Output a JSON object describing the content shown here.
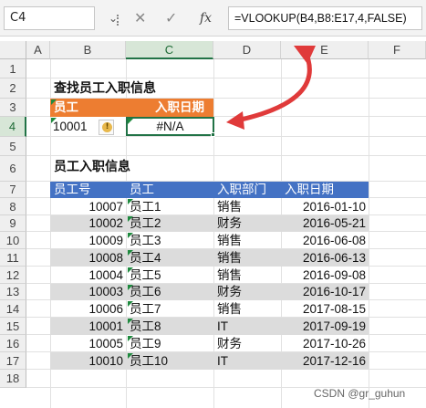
{
  "formula_bar": {
    "name_box": "C4",
    "cancel_icon": "✕",
    "enter_icon": "✓",
    "fx_label": "fx",
    "formula": "=VLOOKUP(B4,B8:E17,4,FALSE)"
  },
  "columns": [
    "A",
    "B",
    "C",
    "D",
    "E",
    "F"
  ],
  "rows": [
    "1",
    "2",
    "3",
    "4",
    "5",
    "6",
    "7",
    "8",
    "9",
    "10",
    "11",
    "12",
    "13",
    "14",
    "15",
    "16",
    "17",
    "18"
  ],
  "lookup": {
    "title": "查找员工入职信息",
    "header_employee": "员工",
    "header_hire_date": "入职日期",
    "employee_value": "10001",
    "result_value": "#N/A",
    "warning_icon": "!"
  },
  "table": {
    "title": "员工入职信息",
    "headers": [
      "员工号",
      "员工",
      "入职部门",
      "入职日期"
    ],
    "rows": [
      [
        "10007",
        "员工1",
        "销售",
        "2016-01-10"
      ],
      [
        "10002",
        "员工2",
        "财务",
        "2016-05-21"
      ],
      [
        "10009",
        "员工3",
        "销售",
        "2016-06-08"
      ],
      [
        "10008",
        "员工4",
        "销售",
        "2016-06-13"
      ],
      [
        "10004",
        "员工5",
        "销售",
        "2016-09-08"
      ],
      [
        "10003",
        "员工6",
        "财务",
        "2016-10-17"
      ],
      [
        "10006",
        "员工7",
        "销售",
        "2017-08-15"
      ],
      [
        "10001",
        "员工8",
        "IT",
        "2017-09-19"
      ],
      [
        "10005",
        "员工9",
        "财务",
        "2017-10-26"
      ],
      [
        "10010",
        "员工10",
        "IT",
        "2017-12-16"
      ]
    ]
  },
  "watermark": "CSDN @gr_guhun",
  "colors": {
    "orange": "#ed7d31",
    "blue": "#4472c4",
    "arrow": "#e03a3a",
    "select": "#217346"
  }
}
